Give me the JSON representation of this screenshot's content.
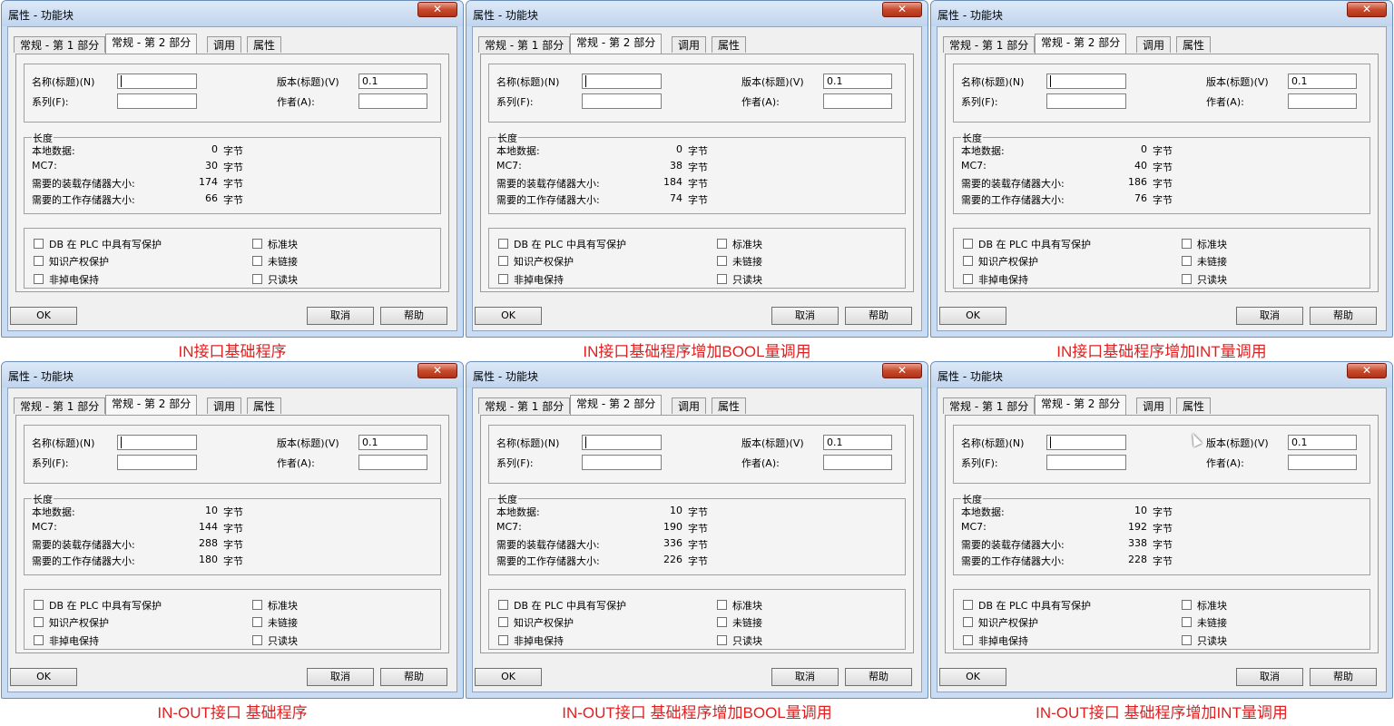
{
  "dialog": {
    "title": "属性 - 功能块",
    "close_glyph": "✕",
    "tabs": [
      "常规 - 第 1 部分",
      "常规 - 第 2 部分",
      "调用",
      "属性"
    ],
    "name_label": "名称(标题)(N)",
    "version_label": "版本(标题)(V)",
    "family_label": "系列(F):",
    "author_label": "作者(A):",
    "version_value": "0.1",
    "length_legend": "长度",
    "local_data_label": "本地数据:",
    "mc7_label": "MC7:",
    "load_mem_label": "需要的装载存储器大小:",
    "work_mem_label": "需要的工作存储器大小:",
    "unit": "字节",
    "checkboxes": {
      "db_protect": "DB 在 PLC 中具有写保护",
      "know_how": "知识产权保护",
      "non_retain": "非掉电保持",
      "standard": "标准块",
      "unlinked": "未链接",
      "read_only": "只读块"
    },
    "ok": "OK",
    "cancel": "取消",
    "help": "帮助"
  },
  "panels": [
    {
      "caption": "IN接口基础程序",
      "local_data": "0",
      "mc7": "30",
      "load_mem": "174",
      "work_mem": "66"
    },
    {
      "caption": "IN接口基础程序增加BOOL量调用",
      "local_data": "0",
      "mc7": "38",
      "load_mem": "184",
      "work_mem": "74"
    },
    {
      "caption": "IN接口基础程序增加INT量调用",
      "local_data": "0",
      "mc7": "40",
      "load_mem": "186",
      "work_mem": "76"
    },
    {
      "caption": "IN-OUT接口 基础程序",
      "local_data": "10",
      "mc7": "144",
      "load_mem": "288",
      "work_mem": "180"
    },
    {
      "caption": "IN-OUT接口 基础程序增加BOOL量调用",
      "local_data": "10",
      "mc7": "190",
      "load_mem": "336",
      "work_mem": "226"
    },
    {
      "caption": "IN-OUT接口 基础程序增加INT量调用",
      "local_data": "10",
      "mc7": "192",
      "load_mem": "338",
      "work_mem": "228"
    }
  ]
}
